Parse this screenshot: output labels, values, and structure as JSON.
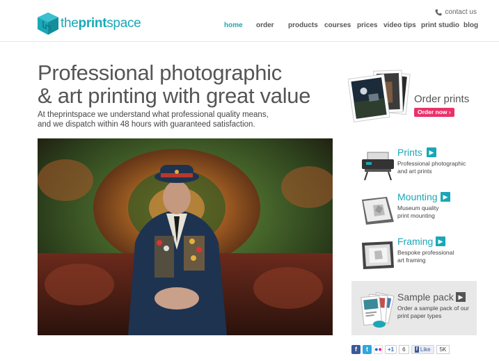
{
  "brand": {
    "logo_text_the": "the",
    "logo_text_print": "print",
    "logo_text_space": "space",
    "accent": "#1aa7b6"
  },
  "header": {
    "contact_label": "contact us",
    "contact_icon": "phone-icon"
  },
  "nav": {
    "items": [
      "home",
      "order",
      "products",
      "courses",
      "prices",
      "video tips",
      "print studio",
      "blog"
    ],
    "active": "home"
  },
  "hero": {
    "headline_line1": "Professional photographic",
    "headline_line2": "& art printing with great value",
    "subline_line1": "At theprintspace we understand what professional quality means,",
    "subline_line2": "and we dispatch within 48 hours with guaranteed satisfaction."
  },
  "order": {
    "title": "Order prints",
    "button_label": "Order now",
    "button_color": "#e8336a"
  },
  "services": [
    {
      "title": "Prints",
      "desc_line1": "Professional photographic",
      "desc_line2": "and art prints",
      "icon": "printer-icon"
    },
    {
      "title": "Mounting",
      "desc_line1": "Museum quality",
      "desc_line2": "print mounting",
      "icon": "mounting-icon"
    },
    {
      "title": "Framing",
      "desc_line1": "Bespoke professional",
      "desc_line2": "art framing",
      "icon": "frame-icon"
    }
  ],
  "sample": {
    "title": "Sample pack",
    "desc_line1": "Order a sample pack of our",
    "desc_line2": "print paper types"
  },
  "social": {
    "plusone_label": "+1",
    "plusone_count": "6",
    "like_label": "Like",
    "like_count": "5K"
  }
}
